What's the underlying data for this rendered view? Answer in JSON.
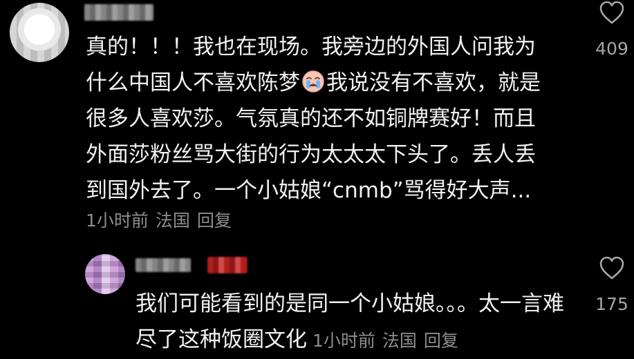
{
  "comments": [
    {
      "text_part1": "真的！！！我也在现场。我旁边的外国人问我为什么中国人不喜欢陈梦",
      "emoji_icon": "crying-emoji-icon",
      "text_part2": "我说没有不喜欢，就是很多人喜欢莎。气氛真的还不如铜牌赛好！而且外面莎粉丝骂大街的行为太太太下头了。丢人丢到国外去了。一个小姑娘“cnmb”骂得好大声...",
      "time": "1小时前",
      "location": "法国",
      "reply_label": "回复",
      "likes": "409"
    },
    {
      "text": "我们可能看到的是同一个小姑娘。。。太一言难尽了这种饭圈文化",
      "time": "1小时前",
      "location": "法国",
      "reply_label": "回复",
      "likes": "175"
    }
  ],
  "icons": {
    "like": "heart-outline-icon"
  },
  "colors": {
    "background": "#000000",
    "text": "#f2f2f2",
    "meta": "#8e8e8e"
  }
}
